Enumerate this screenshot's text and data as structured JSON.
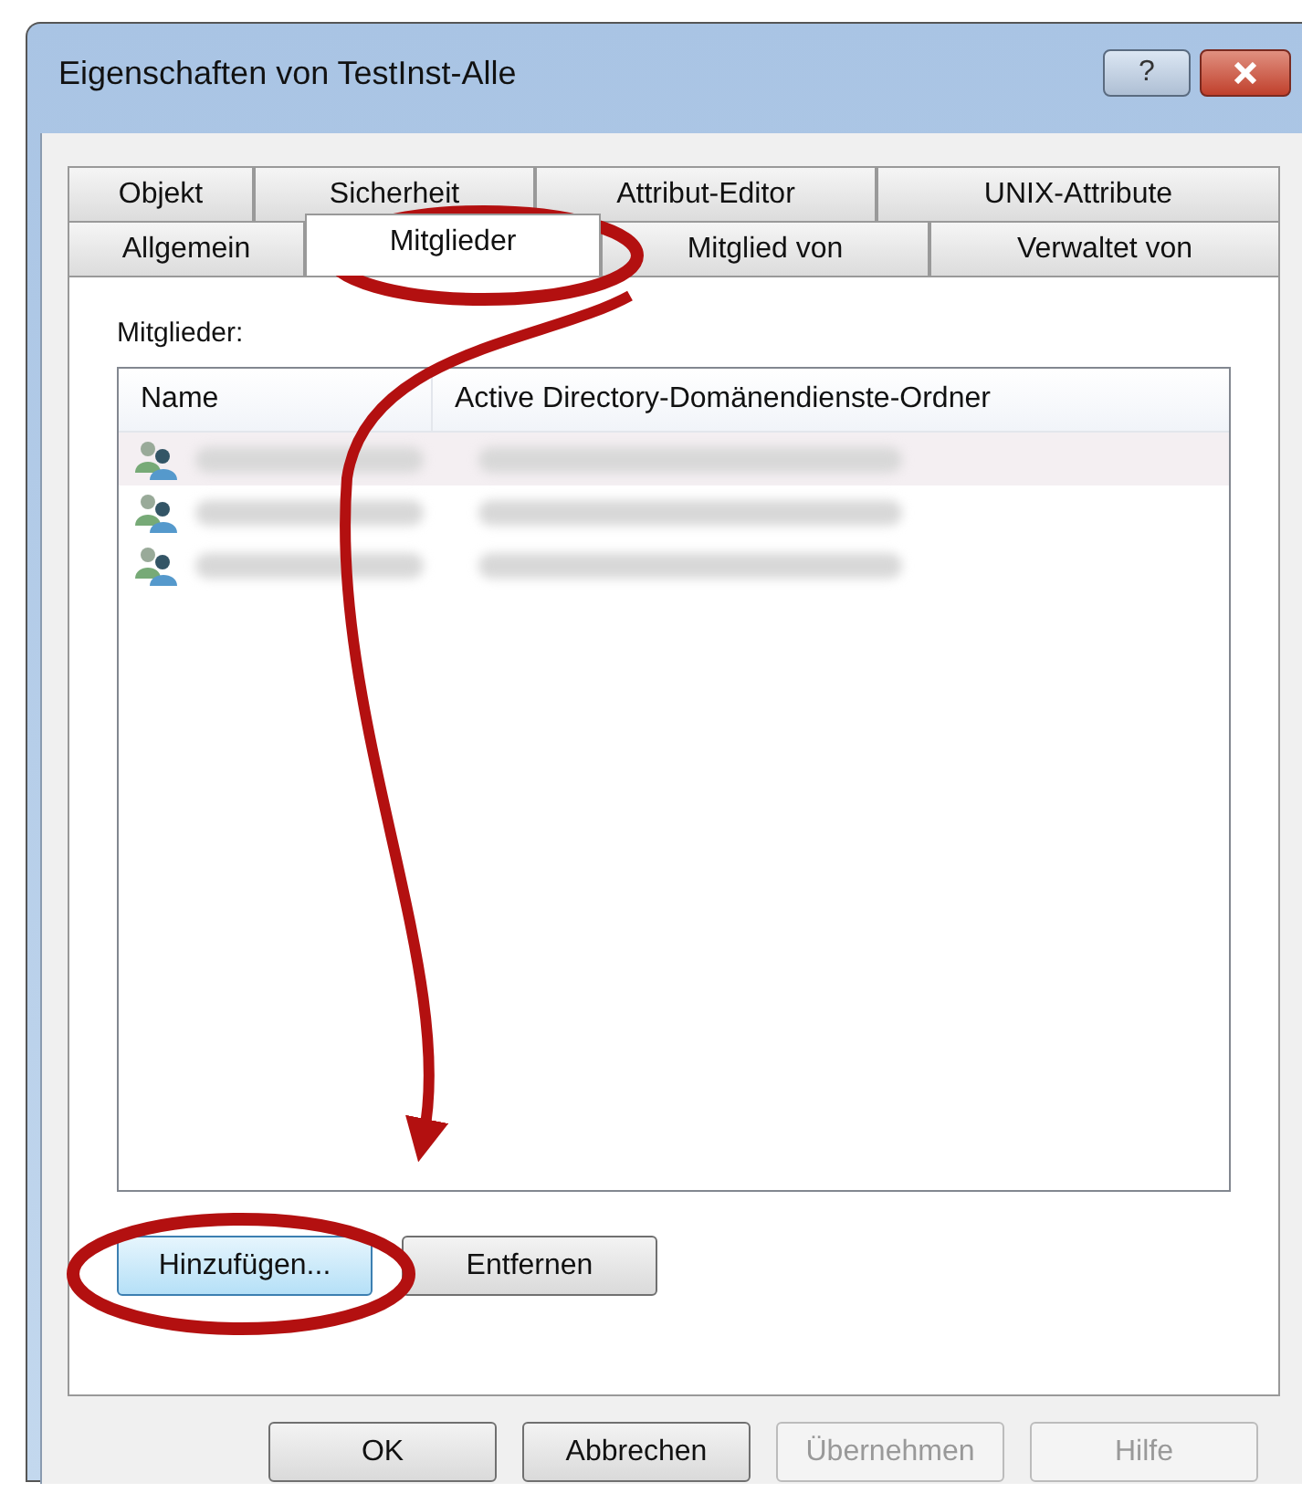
{
  "window": {
    "title": "Eigenschaften von TestInst-Alle",
    "controls": [
      {
        "kind": "help",
        "label": "?"
      },
      {
        "kind": "close"
      }
    ]
  },
  "tabs": [
    [
      {
        "label": "Objekt",
        "selected": false
      },
      {
        "label": "Sicherheit",
        "selected": false
      },
      {
        "label": "Attribut-Editor",
        "selected": false
      },
      {
        "label": "UNIX-Attribute",
        "selected": false
      }
    ],
    [
      {
        "label": "Allgemein",
        "selected": false
      },
      {
        "label": "Mitglieder",
        "selected": true
      },
      {
        "label": "Mitglied von",
        "selected": false
      },
      {
        "label": "Verwaltet von",
        "selected": false
      }
    ]
  ],
  "members": {
    "label": "Mitglieder:",
    "columns": [
      "Name",
      "Active Directory-Domänendienste-Ordner"
    ],
    "rows": [
      {
        "highlighted": true
      },
      {
        "highlighted": false
      },
      {
        "highlighted": false
      }
    ]
  },
  "list_buttons": [
    {
      "label": "Hinzufügen...",
      "focused": true
    },
    {
      "label": "Entfernen",
      "focused": false
    }
  ],
  "dialog_buttons": [
    {
      "label": "OK",
      "disabled": false
    },
    {
      "label": "Abbrechen",
      "disabled": false
    },
    {
      "label": "Übernehmen",
      "disabled": true
    },
    {
      "label": "Hilfe",
      "disabled": true
    }
  ]
}
